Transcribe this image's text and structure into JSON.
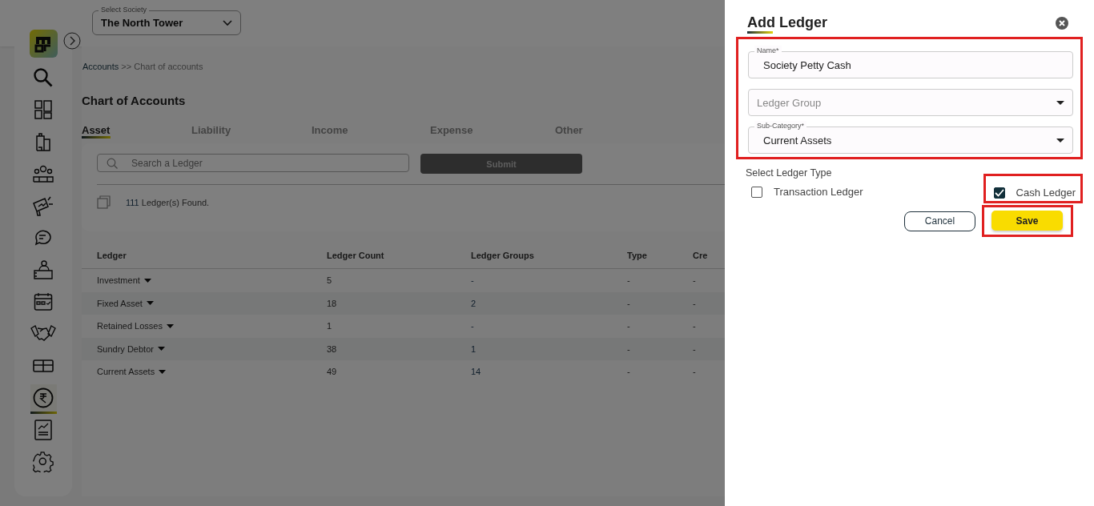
{
  "society_select": {
    "label": "Select Society",
    "value": "The North Tower"
  },
  "sidebar": {
    "items": [
      {
        "kind": "search",
        "selected": false
      },
      {
        "kind": "dashboard",
        "selected": false
      },
      {
        "kind": "building",
        "selected": false
      },
      {
        "kind": "people",
        "selected": false
      },
      {
        "kind": "megaphone",
        "selected": false
      },
      {
        "kind": "chat",
        "selected": false
      },
      {
        "kind": "desk",
        "selected": false
      },
      {
        "kind": "calendar",
        "selected": false
      },
      {
        "kind": "handshake",
        "selected": false
      },
      {
        "kind": "gift",
        "selected": false
      },
      {
        "kind": "rupee",
        "selected": true
      },
      {
        "kind": "report",
        "selected": false
      },
      {
        "kind": "settings",
        "selected": false
      }
    ]
  },
  "breadcrumb": {
    "link": "Accounts",
    "current": ">> Chart of accounts"
  },
  "page_title": "Chart of Accounts",
  "tabs": [
    {
      "label": "Asset",
      "selected": true
    },
    {
      "label": "Liability",
      "selected": false
    },
    {
      "label": "Income",
      "selected": false
    },
    {
      "label": "Expense",
      "selected": false
    },
    {
      "label": "Other",
      "selected": false
    }
  ],
  "search": {
    "placeholder": "Search a Ledger"
  },
  "submit_button": "Submit",
  "found": {
    "count": "111",
    "text": "Ledger(s) Found."
  },
  "table": {
    "columns": [
      "Ledger",
      "Ledger Count",
      "Ledger Groups",
      "Type",
      "Cre"
    ],
    "rows": [
      [
        "Investment",
        "5",
        "-",
        "-",
        "-"
      ],
      [
        "Fixed Asset",
        "18",
        "2",
        "-",
        "-"
      ],
      [
        "Retained Losses",
        "1",
        "-",
        "-",
        "-"
      ],
      [
        "Sundry Debtor",
        "38",
        "1",
        "-",
        "-"
      ],
      [
        "Current Assets",
        "49",
        "14",
        "-",
        "-"
      ]
    ]
  },
  "drawer": {
    "title": "Add Ledger",
    "form_highlighted": true,
    "name_field": {
      "label": "Name*",
      "value": "Society Petty Cash"
    },
    "group_field": {
      "placeholder": "Ledger Group"
    },
    "subcategory_field": {
      "label": "Sub-Category*",
      "value": "Current Assets"
    },
    "type_label": "Select Ledger Type",
    "options": [
      {
        "label": "Transaction Ledger",
        "checked": false,
        "highlighted": false
      },
      {
        "label": "Cash Ledger",
        "checked": true,
        "highlighted": true
      }
    ],
    "cancel_button": "Cancel",
    "save_button": {
      "label": "Save",
      "highlighted": true
    }
  }
}
